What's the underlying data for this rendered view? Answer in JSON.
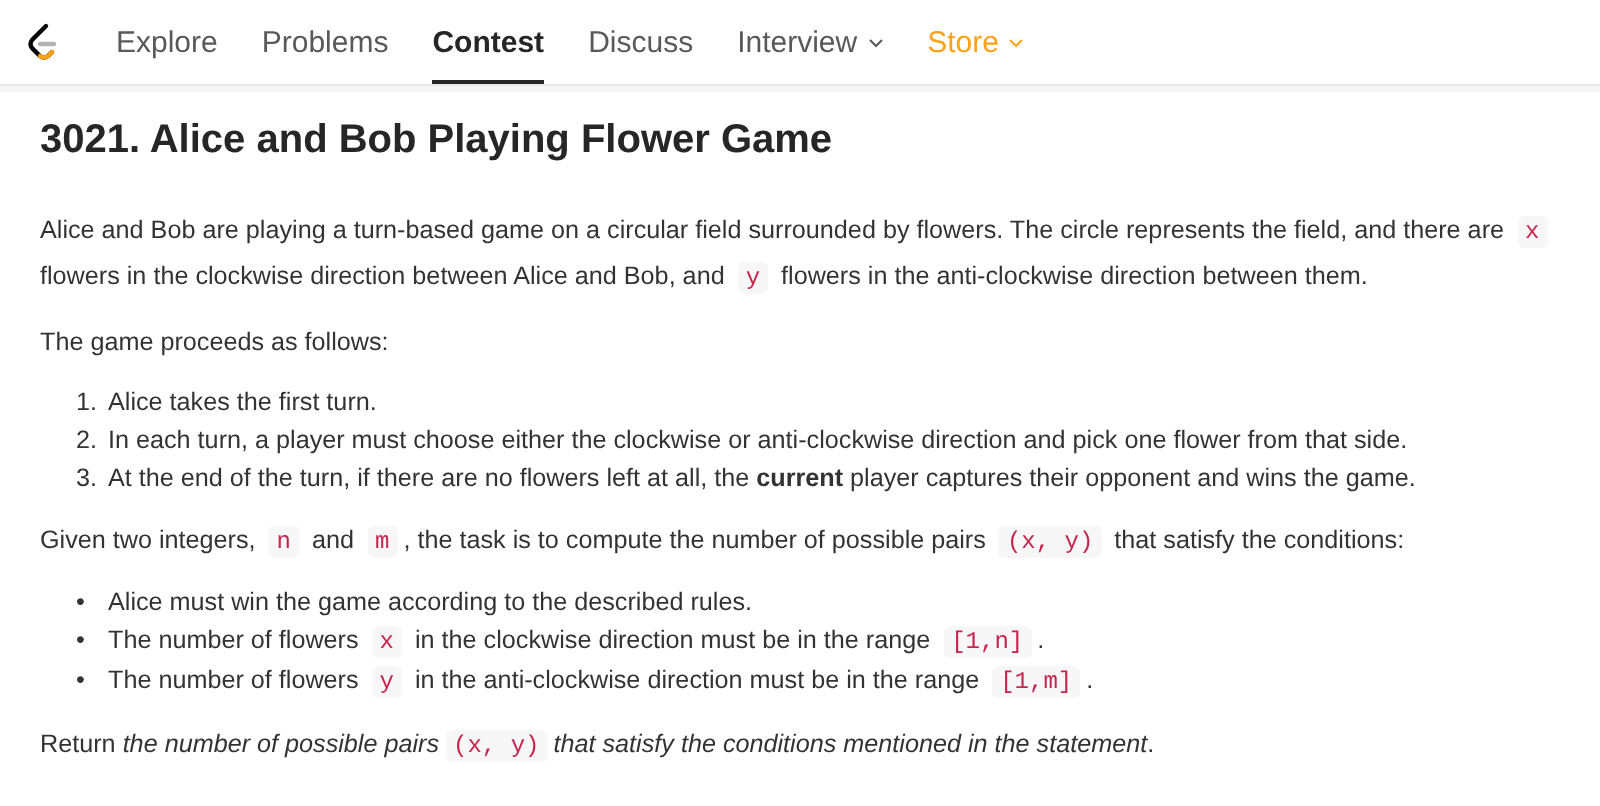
{
  "nav": {
    "items": [
      {
        "label": "Explore",
        "selected": false,
        "dropdown": false,
        "color": "#595959"
      },
      {
        "label": "Problems",
        "selected": false,
        "dropdown": false,
        "color": "#595959"
      },
      {
        "label": "Contest",
        "selected": true,
        "dropdown": false,
        "color": "#262626"
      },
      {
        "label": "Discuss",
        "selected": false,
        "dropdown": false,
        "color": "#595959"
      },
      {
        "label": "Interview",
        "selected": false,
        "dropdown": true,
        "color": "#595959"
      },
      {
        "label": "Store",
        "selected": false,
        "dropdown": true,
        "color": "#ffa116"
      }
    ]
  },
  "problem": {
    "title": "3021. Alice and Bob Playing Flower Game",
    "blocks": [
      {
        "kind": "p",
        "segments": [
          {
            "code": false,
            "text": "Alice and Bob are playing a turn-based game on a circular field surrounded by flowers. The circle represents the field, and there are "
          },
          {
            "code": true,
            "text": "x"
          },
          {
            "code": false,
            "text": " flowers in the clockwise direction between Alice and Bob, and "
          },
          {
            "code": true,
            "text": "y"
          },
          {
            "code": false,
            "text": " flowers in the anti-clockwise direction between them."
          }
        ]
      },
      {
        "kind": "p",
        "segments": [
          {
            "code": false,
            "text": "The game proceeds as follows:"
          }
        ]
      },
      {
        "kind": "list",
        "items": [
          {
            "marker": "1.",
            "segments": [
              {
                "code": false,
                "text": "Alice takes the first turn."
              }
            ]
          },
          {
            "marker": "2.",
            "segments": [
              {
                "code": false,
                "text": "In each turn, a player must choose either the clockwise or anti-clockwise direction and pick one flower from that side."
              }
            ]
          },
          {
            "marker": "3.",
            "segments": [
              {
                "code": false,
                "text": "At the end of the turn, if there are no flowers left at all, the **current** player captures their opponent and wins the game."
              }
            ]
          }
        ]
      },
      {
        "kind": "p",
        "segments": [
          {
            "code": false,
            "text": "Given two integers, "
          },
          {
            "code": true,
            "text": "n"
          },
          {
            "code": false,
            "text": " and "
          },
          {
            "code": true,
            "text": "m"
          },
          {
            "code": false,
            "text": ", the task is to compute the number of possible pairs "
          },
          {
            "code": true,
            "text": "(x, y)"
          },
          {
            "code": false,
            "text": " that satisfy the conditions:"
          }
        ]
      },
      {
        "kind": "list",
        "items": [
          {
            "marker": "•",
            "segments": [
              {
                "code": false,
                "text": "Alice must win the game according to the described rules."
              }
            ]
          },
          {
            "marker": "•",
            "segments": [
              {
                "code": false,
                "text": "The number of flowers "
              },
              {
                "code": true,
                "text": "x"
              },
              {
                "code": false,
                "text": " in the clockwise direction must be in the range "
              },
              {
                "code": true,
                "text": "[1,n]"
              },
              {
                "code": false,
                "text": "."
              }
            ]
          },
          {
            "marker": "•",
            "segments": [
              {
                "code": false,
                "text": "The number of flowers "
              },
              {
                "code": true,
                "text": "y"
              },
              {
                "code": false,
                "text": " in the anti-clockwise direction must be in the range "
              },
              {
                "code": true,
                "text": "[1,m]"
              },
              {
                "code": false,
                "text": "."
              }
            ]
          }
        ]
      },
      {
        "kind": "p",
        "segments": [
          {
            "code": false,
            "text": "Return *the number of possible pairs*"
          },
          {
            "code": true,
            "text": "(x, y)"
          },
          {
            "code": false,
            "text": "*that satisfy the conditions mentioned in the statement*."
          }
        ]
      }
    ]
  }
}
